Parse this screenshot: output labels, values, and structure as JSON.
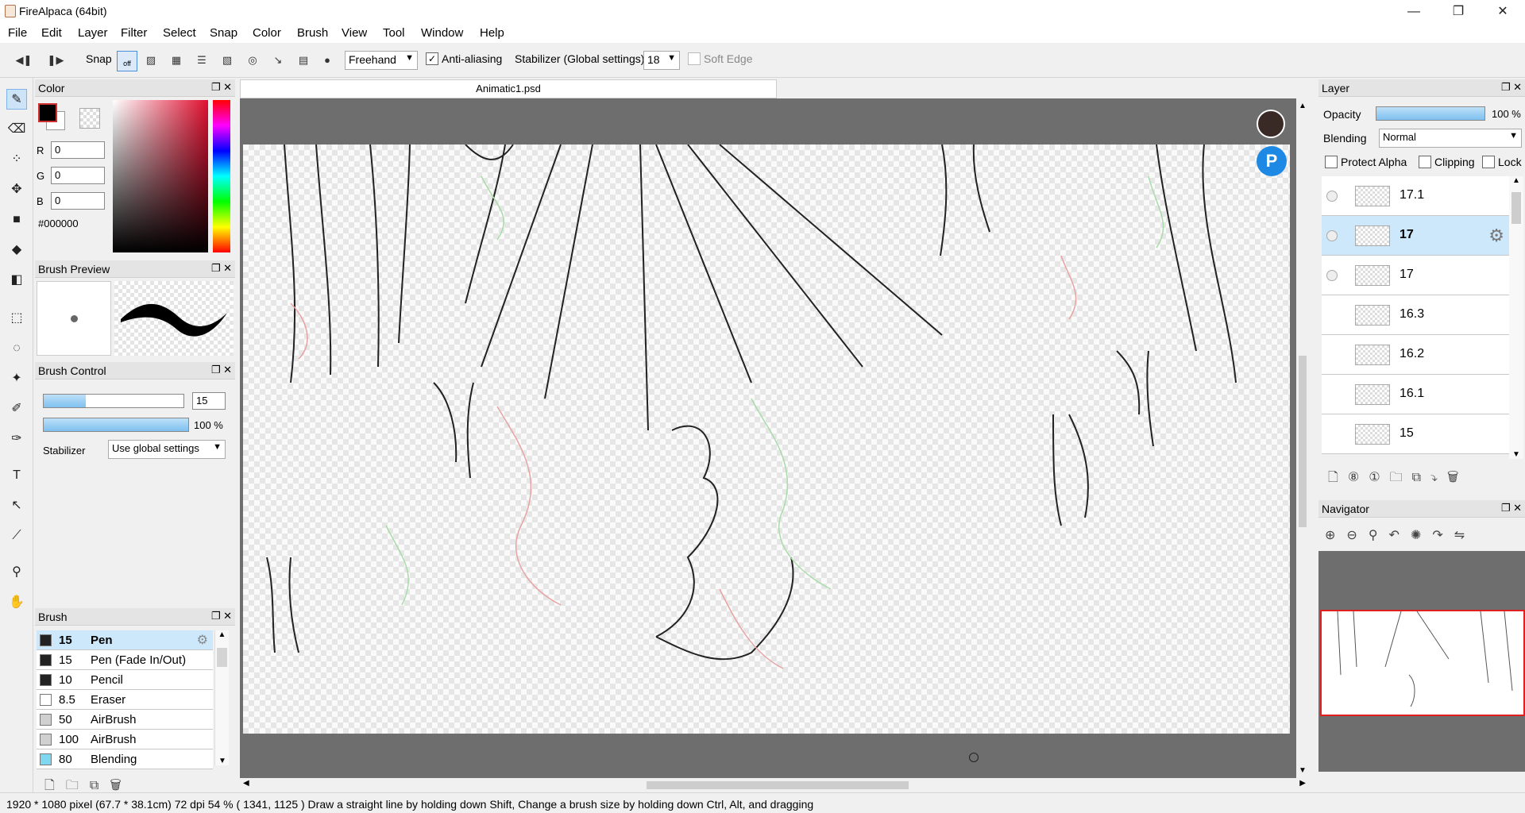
{
  "window": {
    "title": "FireAlpaca (64bit)",
    "minimize": "—",
    "maximize": "❐",
    "close": "✕"
  },
  "menu": [
    "File",
    "Edit",
    "Layer",
    "Filter",
    "Select",
    "Snap",
    "Color",
    "Brush",
    "View",
    "Tool",
    "Window",
    "Help"
  ],
  "toolbar": {
    "snap_label": "Snap",
    "snap_off": "off",
    "draw_mode": "Freehand",
    "antialias_label": "Anti-aliasing",
    "antialias_checked": true,
    "stabilizer_label": "Stabilizer (Global settings)",
    "stabilizer_value": "18",
    "soft_edge_label": "Soft Edge"
  },
  "color_panel": {
    "title": "Color",
    "r_label": "R",
    "r": "0",
    "g_label": "G",
    "g": "0",
    "b_label": "B",
    "b": "0",
    "hex": "#000000"
  },
  "brush_preview": {
    "title": "Brush Preview"
  },
  "brush_control": {
    "title": "Brush Control",
    "size": "15",
    "opacity": "100 %",
    "size_fill": 0.3,
    "opacity_fill": 1.0,
    "stabilizer_label": "Stabilizer",
    "stabilizer_value": "Use global settings"
  },
  "brush_panel": {
    "title": "Brush",
    "items": [
      {
        "size": "15",
        "name": "Pen",
        "color": "#222222",
        "selected": true
      },
      {
        "size": "15",
        "name": "Pen (Fade In/Out)",
        "color": "#222222"
      },
      {
        "size": "10",
        "name": "Pencil",
        "color": "#222222"
      },
      {
        "size": "8.5",
        "name": "Eraser",
        "color": "#ffffff"
      },
      {
        "size": "50",
        "name": "AirBrush",
        "color": "#d0d0d0"
      },
      {
        "size": "100",
        "name": "AirBrush",
        "color": "#d0d0d0"
      },
      {
        "size": "80",
        "name": "Blending",
        "color": "#7fd8f0"
      }
    ]
  },
  "document": {
    "tab": "Animatic1.psd"
  },
  "layer_panel": {
    "title": "Layer",
    "opacity_label": "Opacity",
    "opacity_value": "100 %",
    "blending_label": "Blending",
    "blending_value": "Normal",
    "protect_alpha": "Protect Alpha",
    "clipping": "Clipping",
    "lock": "Lock",
    "layers": [
      {
        "name": "17.1"
      },
      {
        "name": "17",
        "selected": true
      },
      {
        "name": "17"
      },
      {
        "name": "16.3"
      },
      {
        "name": "16.2"
      },
      {
        "name": "16.1"
      },
      {
        "name": "15"
      }
    ]
  },
  "navigator": {
    "title": "Navigator"
  },
  "status": "1920 * 1080 pixel   (67.7 * 38.1cm)   72 dpi   54 %   ( 1341, 1125 )   Draw a straight line by holding down Shift, Change a brush size by holding down Ctrl, Alt, and dragging"
}
